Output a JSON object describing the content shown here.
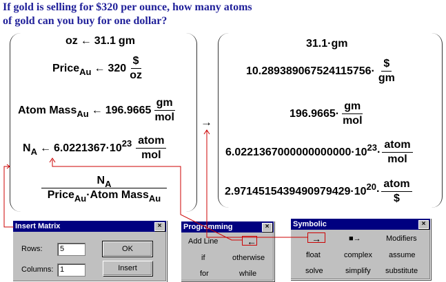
{
  "question": {
    "line1": "If gold is selling for $320 per ounce, how many atoms",
    "line2": "of gold can you buy for one dollar?"
  },
  "left_panel": {
    "oz": {
      "name": "oz",
      "arrow": "←",
      "value": "31.1",
      "unit": "gm"
    },
    "price": {
      "name": "Price",
      "sub": "Au",
      "arrow": "←",
      "value": "320",
      "num": "$",
      "den": "oz"
    },
    "atom_mass": {
      "name": "Atom Mass",
      "sub": "Au",
      "arrow": "←",
      "value": "196.9665",
      "num": "gm",
      "den": "mol"
    },
    "avogadro": {
      "name": "N",
      "sub": "A",
      "arrow": "←",
      "mantissa": "6.0221367·10",
      "exp": "23",
      "num": "atom",
      "den": "mol"
    },
    "result": {
      "num_name": "N",
      "num_sub": "A",
      "den_price": "Price",
      "den_price_sub": "Au",
      "dot": "·",
      "den_mass": "Atom Mass",
      "den_mass_sub": "Au"
    }
  },
  "eval_arrow": "→",
  "right_panel": {
    "r1": {
      "text": "31.1·gm"
    },
    "r2": {
      "value": "10.289389067524115756·",
      "num": "$",
      "den": "gm"
    },
    "r3": {
      "value": "196.9665·",
      "num": "gm",
      "den": "mol"
    },
    "r4": {
      "mantissa": "6.0221367000000000000·10",
      "exp": "23",
      "dot": "·",
      "num": "atom",
      "den": "mol"
    },
    "r5": {
      "mantissa": "2.9714515439490979429·10",
      "exp": "20",
      "dot": "·",
      "num": "atom",
      "den": "$"
    }
  },
  "insert_matrix": {
    "title": "Insert Matrix",
    "close": "×",
    "rows_label": "Rows:",
    "rows_value": "5",
    "columns_label": "Columns:",
    "columns_value": "1",
    "ok_label": "OK",
    "insert_label": "Insert"
  },
  "programming": {
    "title": "Programming",
    "close": "×",
    "add_line": "Add Line",
    "local_define": "←",
    "if": "if",
    "otherwise": "otherwise",
    "for": "for",
    "while": "while"
  },
  "symbolic": {
    "title": "Symbolic",
    "close": "×",
    "evaluate": "→",
    "evaluate_keyword": "■→",
    "modifiers": "Modifiers",
    "float": "float",
    "complex": "complex",
    "assume": "assume",
    "solve": "solve",
    "simplify": "simplify",
    "substitute": "substitute"
  },
  "colors": {
    "title_blue": "#000080",
    "question_blue": "#1f1f99",
    "annotation_red": "#cc0000",
    "window_gray": "#c0c0c0"
  }
}
